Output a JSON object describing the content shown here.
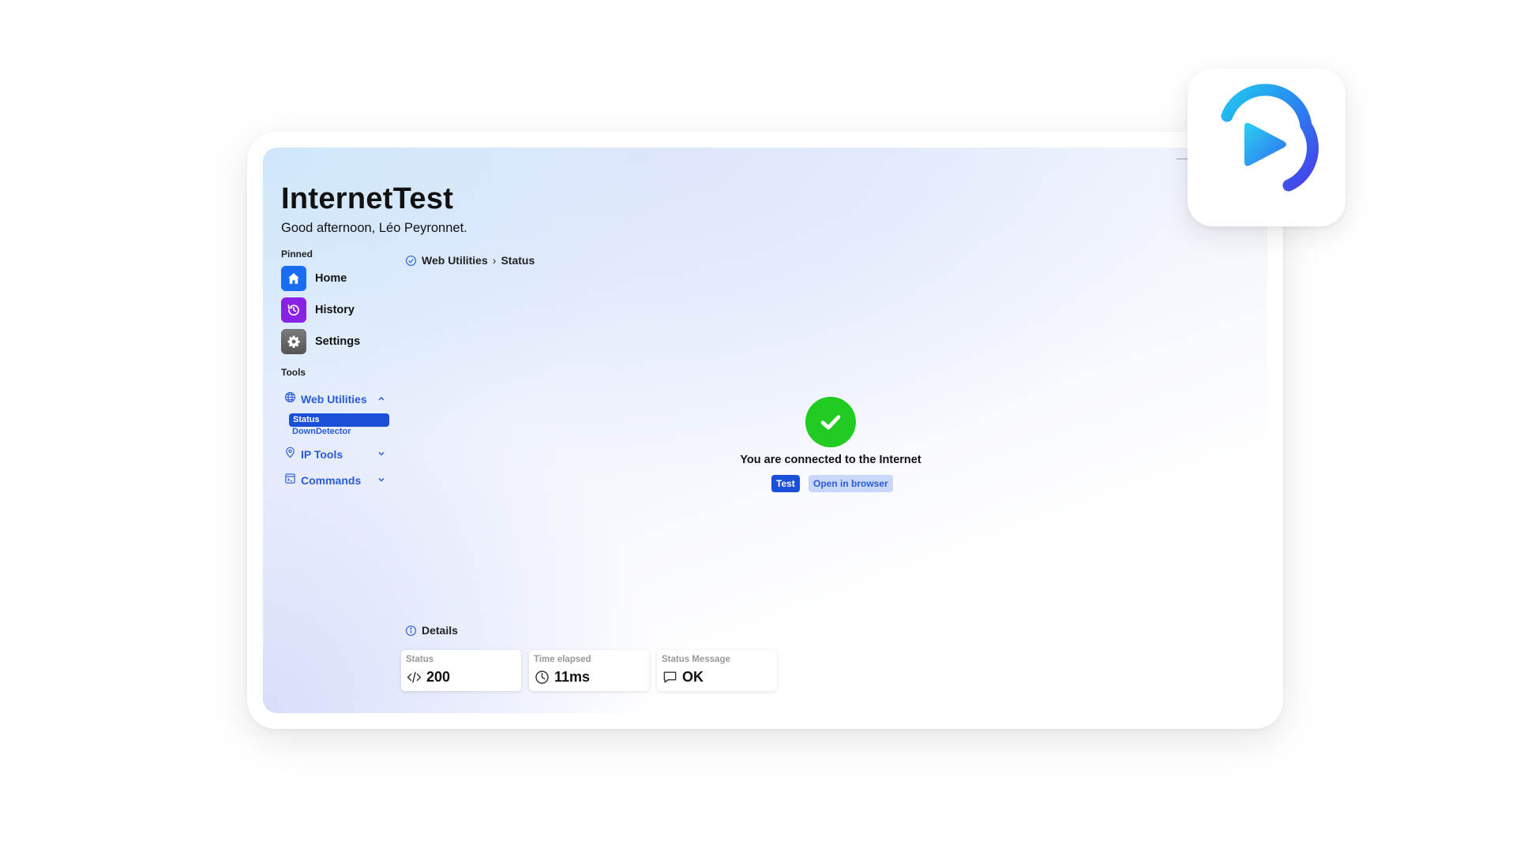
{
  "app": {
    "title": "InternetTest",
    "greeting": "Good afternoon, Léo Peyronnet."
  },
  "window_controls": {
    "minimize_glyph": "—"
  },
  "sidebar": {
    "pinned_label": "Pinned",
    "pinned": [
      {
        "label": "Home",
        "icon": "home-icon",
        "color": "#1a6cf0"
      },
      {
        "label": "History",
        "icon": "history-icon",
        "color": "#8a22e6"
      },
      {
        "label": "Settings",
        "icon": "gear-icon",
        "color": "#6b6b6b"
      }
    ],
    "tools_label": "Tools",
    "tools": [
      {
        "label": "Web Utilities",
        "icon": "globe-icon",
        "expanded": true,
        "items": [
          {
            "label": "Status",
            "active": true
          },
          {
            "label": "DownDetector",
            "active": false
          }
        ]
      },
      {
        "label": "IP Tools",
        "icon": "location-pin-icon",
        "expanded": false
      },
      {
        "label": "Commands",
        "icon": "terminal-icon",
        "expanded": false
      }
    ]
  },
  "breadcrumb": {
    "section": "Web Utilities",
    "separator": "›",
    "page": "Status"
  },
  "status": {
    "message": "You are connected to the Internet",
    "test_button": "Test",
    "open_button": "Open in browser",
    "ok_color": "#21cc21"
  },
  "details": {
    "title": "Details",
    "cards": [
      {
        "label": "Status",
        "value": "200",
        "icon": "code-icon"
      },
      {
        "label": "Time elapsed",
        "value": "11ms",
        "icon": "clock-icon"
      },
      {
        "label": "Status Message",
        "value": "OK",
        "icon": "message-icon"
      }
    ]
  },
  "colors": {
    "accent": "#1a4fd8",
    "link": "#2a5bd7"
  }
}
